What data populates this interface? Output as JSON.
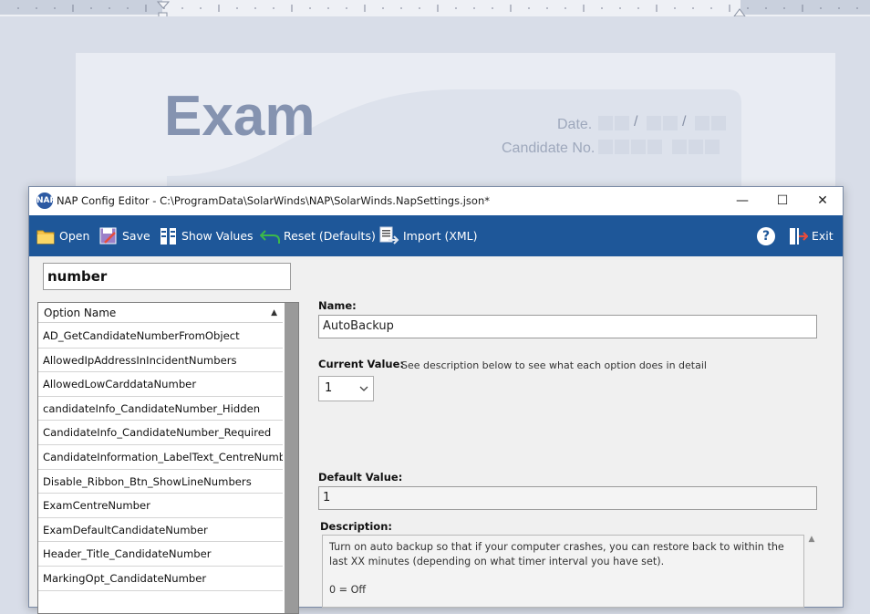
{
  "background_doc": {
    "title": "Exam",
    "date_label": "Date.",
    "candidate_label": "Candidate No.",
    "date_separator": "/"
  },
  "window": {
    "icon_text": "NAP",
    "title": "NAP Config Editor - C:\\ProgramData\\SolarWinds\\NAP\\SolarWinds.NapSettings.json*",
    "minimize": "—",
    "maximize": "☐",
    "close": "✕"
  },
  "toolbar": {
    "open": "Open",
    "save": "Save",
    "show_values": "Show Values",
    "reset": "Reset (Defaults)",
    "import": "Import (XML)",
    "help": "?",
    "exit": "Exit"
  },
  "search": {
    "value": "number"
  },
  "list": {
    "header": "Option Name",
    "sort_glyph": "▲",
    "items": [
      "AD_GetCandidateNumberFromObject",
      "AllowedIpAddressInIncidentNumbers",
      "AllowedLowCarddataNumber",
      "candidateInfo_CandidateNumber_Hidden",
      "CandidateInfo_CandidateNumber_Required",
      "CandidateInformation_LabelText_CentreNumber",
      "Disable_Ribbon_Btn_ShowLineNumbers",
      "ExamCentreNumber",
      "ExamDefaultCandidateNumber",
      "Header_Title_CandidateNumber",
      "MarkingOpt_CandidateNumber"
    ]
  },
  "detail": {
    "name_label": "Name:",
    "name_value": "AutoBackup",
    "current_label": "Current Value:",
    "current_hint": "See description below to see what each option does in detail",
    "current_value": "1",
    "default_label": "Default Value:",
    "default_value": "1",
    "description_label": "Description:",
    "description_line1": "Turn on auto backup so that if your computer crashes, you can restore back to within the last XX minutes (depending on what timer interval you have set).",
    "description_line2": "0 = Off"
  },
  "colors": {
    "toolbar_bg": "#1e5799",
    "exam_title": "#8593b0"
  }
}
